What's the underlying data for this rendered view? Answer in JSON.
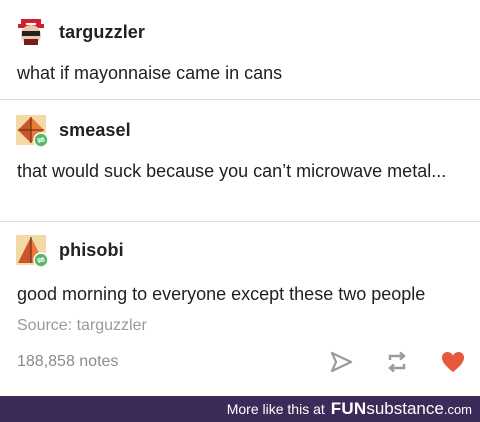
{
  "posts": [
    {
      "username": "targuzzler",
      "avatar": "red-black-fedora-avatar-icon",
      "text": "what if mayonnaise came in cans"
    },
    {
      "username": "smeasel",
      "avatar": "orange-geometric-avatar-icon",
      "text": "that would suck because you can’t microwave metal..."
    },
    {
      "username": "phisobi",
      "avatar": "orange-geometric-avatar-icon",
      "text": "good morning to everyone except these two people"
    }
  ],
  "source": "Source: targuzzler",
  "notes": "188,858 notes",
  "actions": {
    "share_icon": "paper-plane-icon",
    "reblog_icon": "reblog-icon",
    "like_icon": "heart-icon",
    "like_color": "#e8593c"
  },
  "footer": {
    "more_text": "More like this at",
    "brand_fun": "FUN",
    "brand_sub": "substance",
    "brand_dot": ".com"
  },
  "colors": {
    "footer_bg": "#3c2b58",
    "reblog_badge": "#57b96a",
    "avatar_orange": "#e87a3c"
  }
}
